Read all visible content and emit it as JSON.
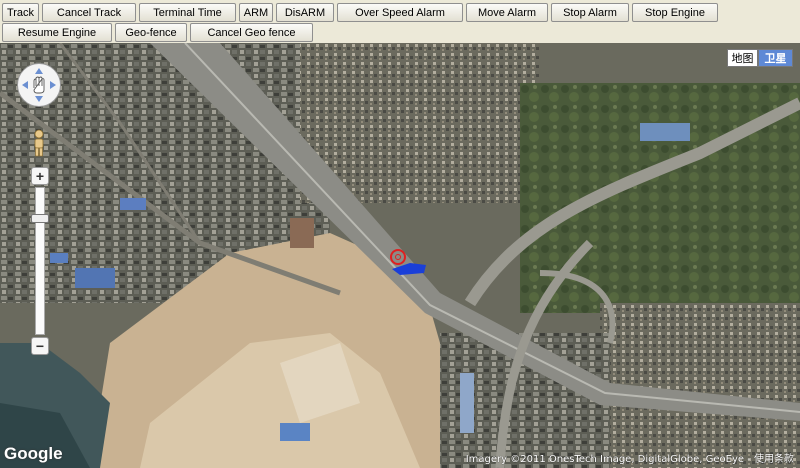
{
  "toolbar": {
    "row1": [
      "Track",
      "Cancel Track",
      "Terminal Time",
      "ARM",
      "DisARM",
      "Over Speed Alarm",
      "Move Alarm",
      "Stop Alarm",
      "Stop Engine"
    ],
    "row2": [
      "Resume Engine",
      "Geo-fence",
      "Cancel Geo fence"
    ]
  },
  "map": {
    "type_buttons": {
      "map": "地图",
      "satellite": "卫星",
      "active": "satellite"
    },
    "logo": "Google",
    "attribution": "Imagery ©2011 OnesTech Image, DigitalGlobe, GeoEye - 使用条款",
    "controls": {
      "zoom_in": "+",
      "zoom_out": "−"
    },
    "icons": [
      "pan-control-icon",
      "pegman-icon",
      "vehicle-marker-icon"
    ]
  }
}
